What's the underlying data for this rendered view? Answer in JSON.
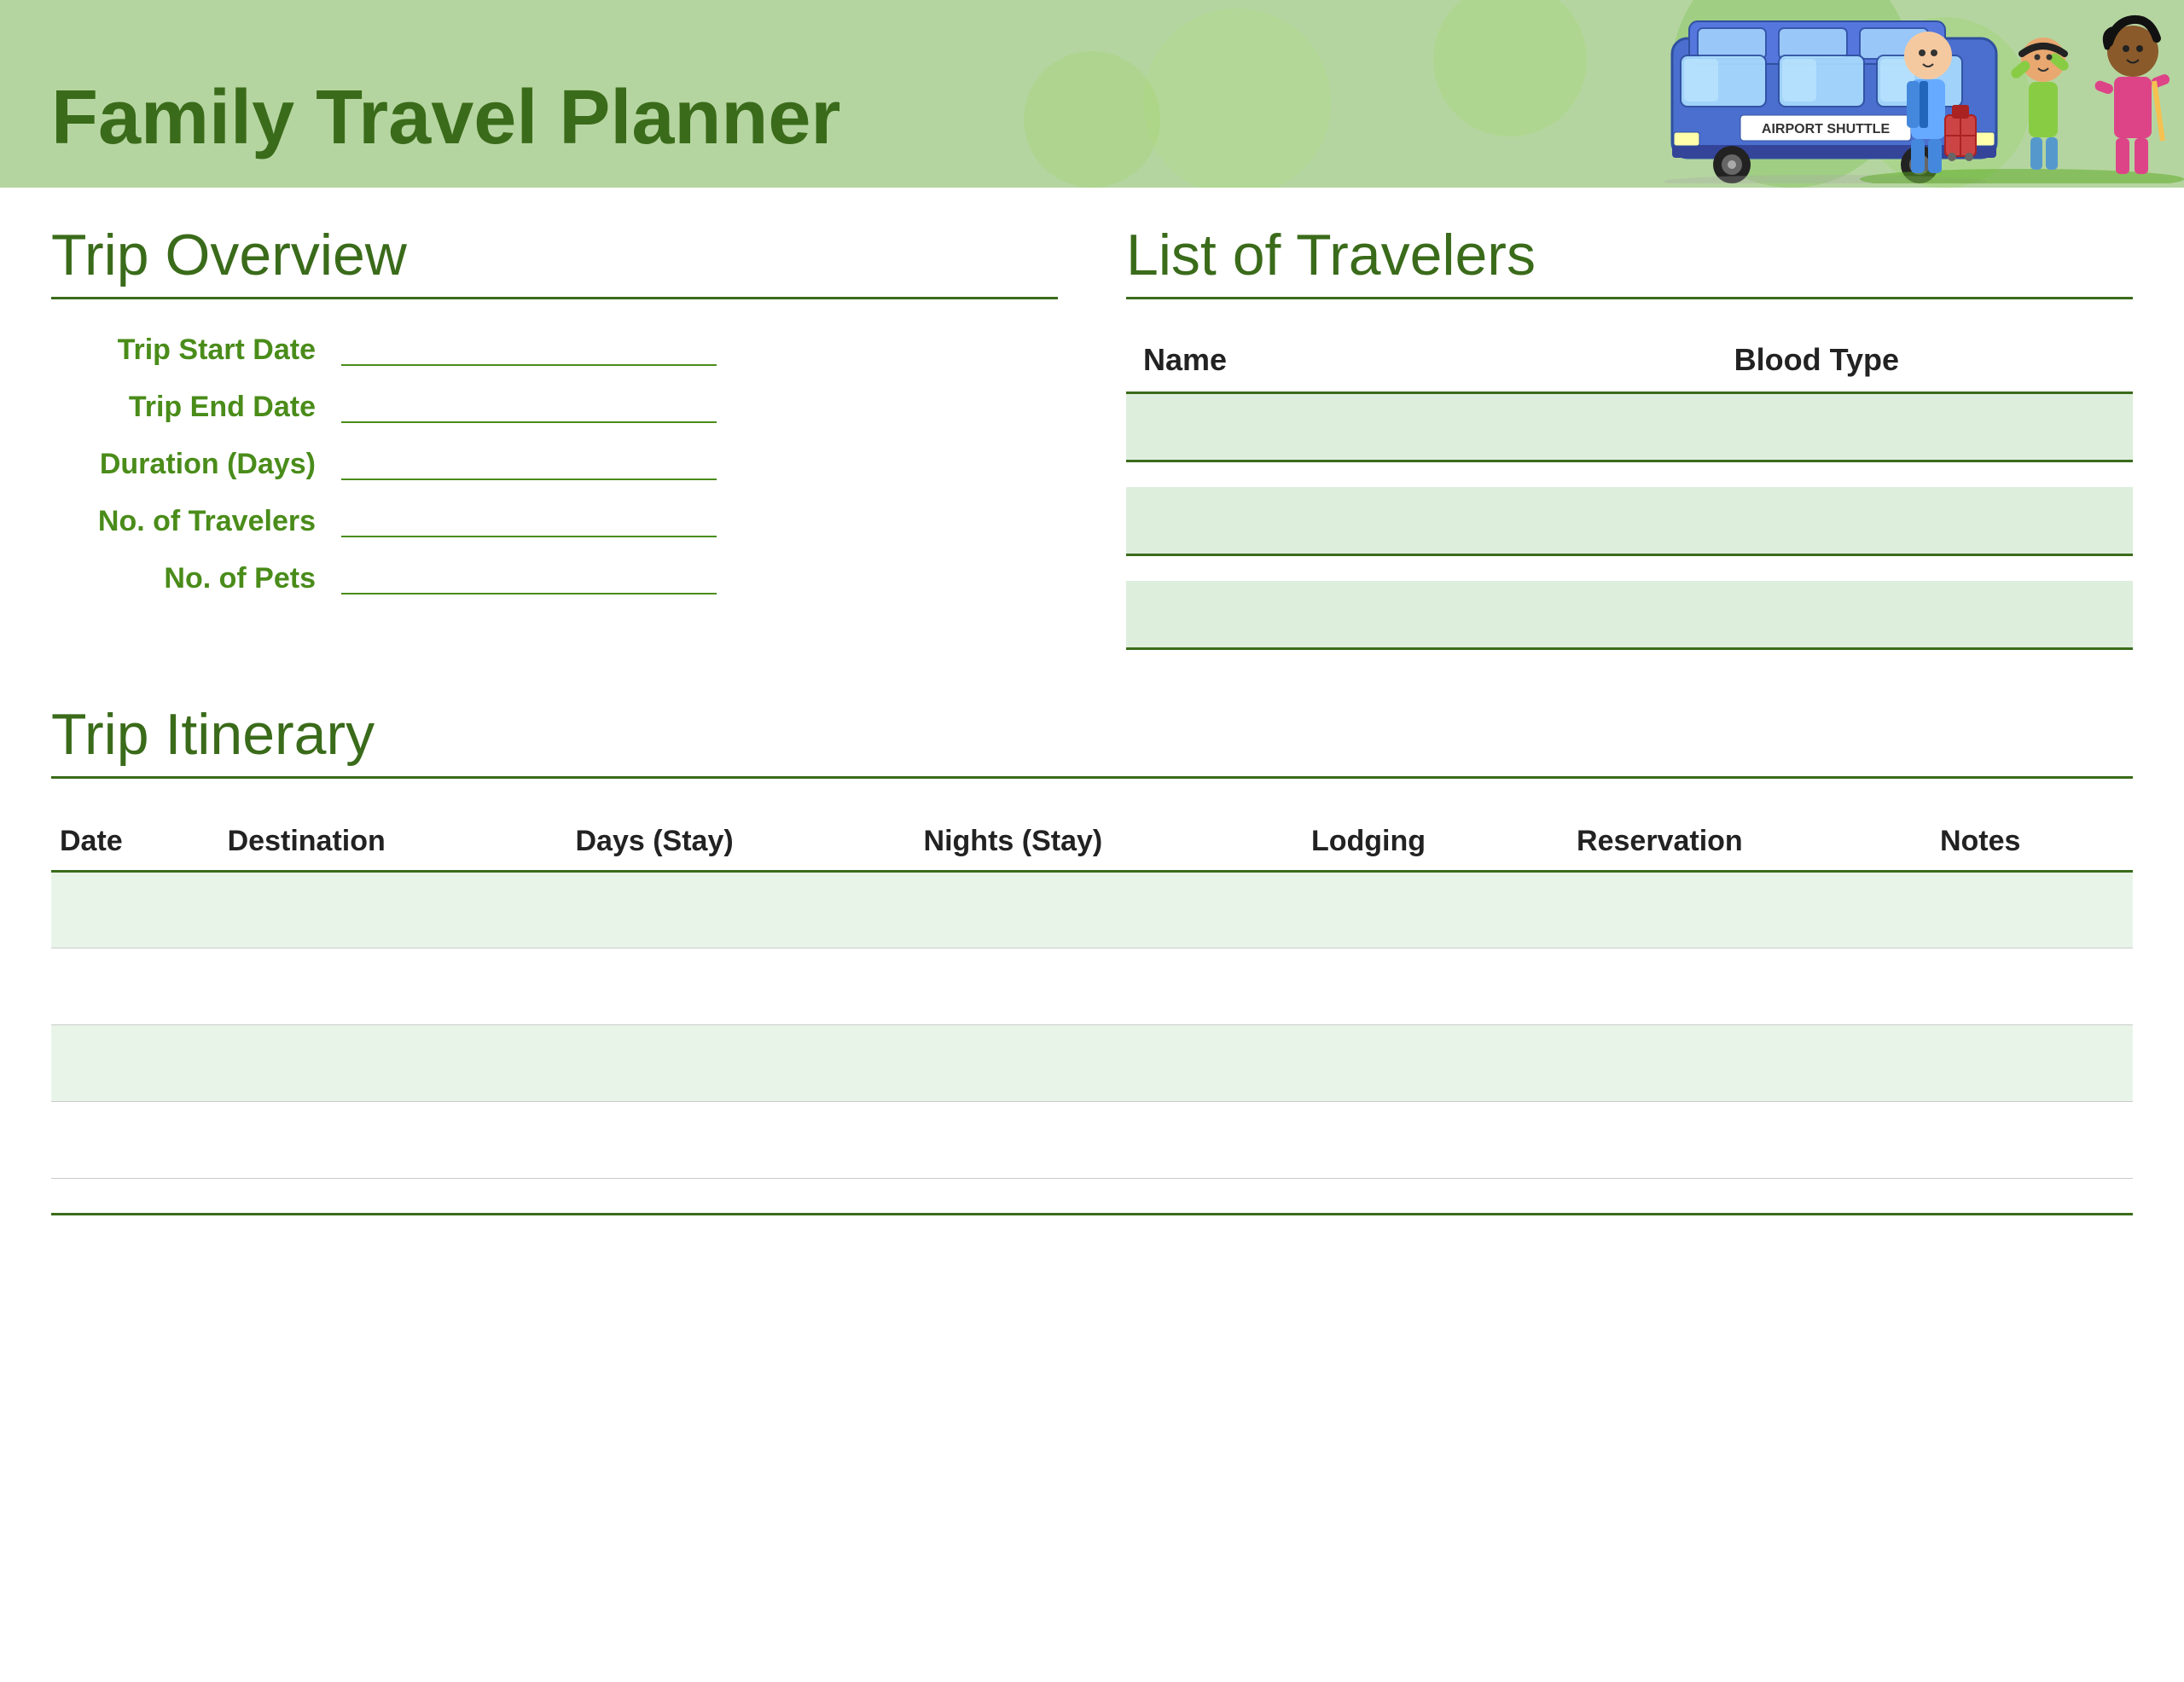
{
  "header": {
    "title": "Family Travel Planner",
    "bus_label": "AIRPORT SHUTTLE"
  },
  "trip_overview": {
    "section_title": "Trip Overview",
    "fields": [
      {
        "label": "Trip Start Date",
        "value": ""
      },
      {
        "label": "Trip End Date",
        "value": ""
      },
      {
        "label": "Duration (Days)",
        "value": ""
      },
      {
        "label": "No. of Travelers",
        "value": ""
      },
      {
        "label": "No. of Pets",
        "value": ""
      }
    ]
  },
  "travelers": {
    "section_title": "List of Travelers",
    "columns": [
      "Name",
      "Blood Type"
    ],
    "rows": [
      {
        "name": "",
        "blood_type": ""
      },
      {
        "name": "",
        "blood_type": ""
      },
      {
        "name": "",
        "blood_type": ""
      }
    ]
  },
  "itinerary": {
    "section_title": "Trip Itinerary",
    "columns": [
      "Date",
      "Destination",
      "Days (Stay)",
      "Nights (Stay)",
      "Lodging",
      "Reservation",
      "Notes"
    ],
    "rows": [
      {
        "date": "",
        "destination": "",
        "days": "",
        "nights": "",
        "lodging": "",
        "reservation": "",
        "notes": ""
      },
      {
        "date": "",
        "destination": "",
        "days": "",
        "nights": "",
        "lodging": "",
        "reservation": "",
        "notes": ""
      },
      {
        "date": "",
        "destination": "",
        "days": "",
        "nights": "",
        "lodging": "",
        "reservation": "",
        "notes": ""
      },
      {
        "date": "",
        "destination": "",
        "days": "",
        "nights": "",
        "lodging": "",
        "reservation": "",
        "notes": ""
      }
    ]
  }
}
